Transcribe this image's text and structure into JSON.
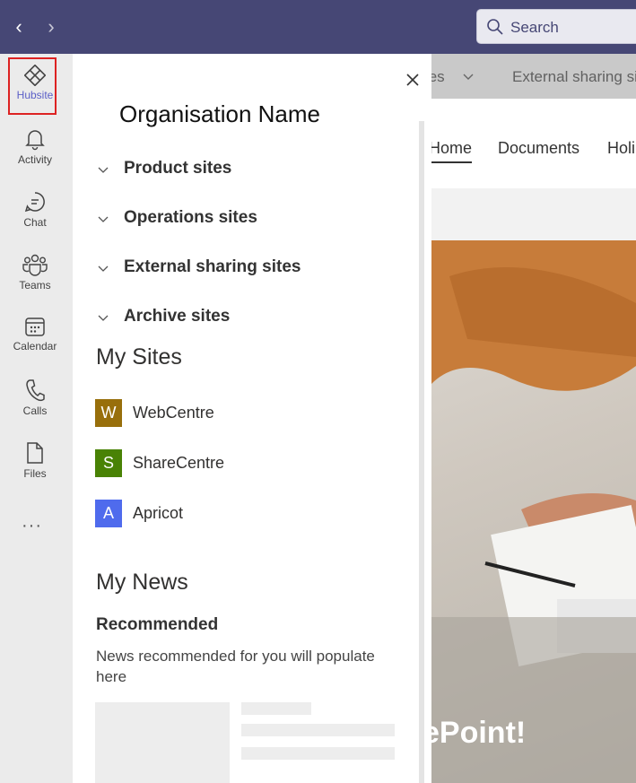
{
  "topbar": {
    "back_symbol": "‹",
    "forward_symbol": "›",
    "search_placeholder": "Search",
    "bg_color": "#464775"
  },
  "rail": {
    "items": [
      {
        "label": "Hubsite",
        "icon": "hubsite-icon"
      },
      {
        "label": "Activity",
        "icon": "bell-icon"
      },
      {
        "label": "Chat",
        "icon": "chat-icon"
      },
      {
        "label": "Teams",
        "icon": "teams-icon"
      },
      {
        "label": "Calendar",
        "icon": "calendar-icon"
      },
      {
        "label": "Calls",
        "icon": "phone-icon"
      },
      {
        "label": "Files",
        "icon": "file-icon"
      }
    ],
    "more": "···"
  },
  "background": {
    "tabs": [
      "tes",
      "External sharing si"
    ],
    "nav": [
      "Home",
      "Documents",
      "Holi"
    ],
    "hero_title": "ePoint!"
  },
  "panel": {
    "org_name": "Organisation Name",
    "sections": [
      "Product sites",
      "Operations sites",
      "External sharing sites",
      "Archive sites"
    ],
    "my_sites_heading": "My Sites",
    "sites": [
      {
        "initial": "W",
        "name": "WebCentre",
        "color": "#986f0b"
      },
      {
        "initial": "S",
        "name": "ShareCentre",
        "color": "#498205"
      },
      {
        "initial": "A",
        "name": "Apricot",
        "color": "#4f6bed"
      }
    ],
    "my_news_heading": "My News",
    "recommended_label": "Recommended",
    "recommended_desc": "News recommended for you will populate here"
  }
}
